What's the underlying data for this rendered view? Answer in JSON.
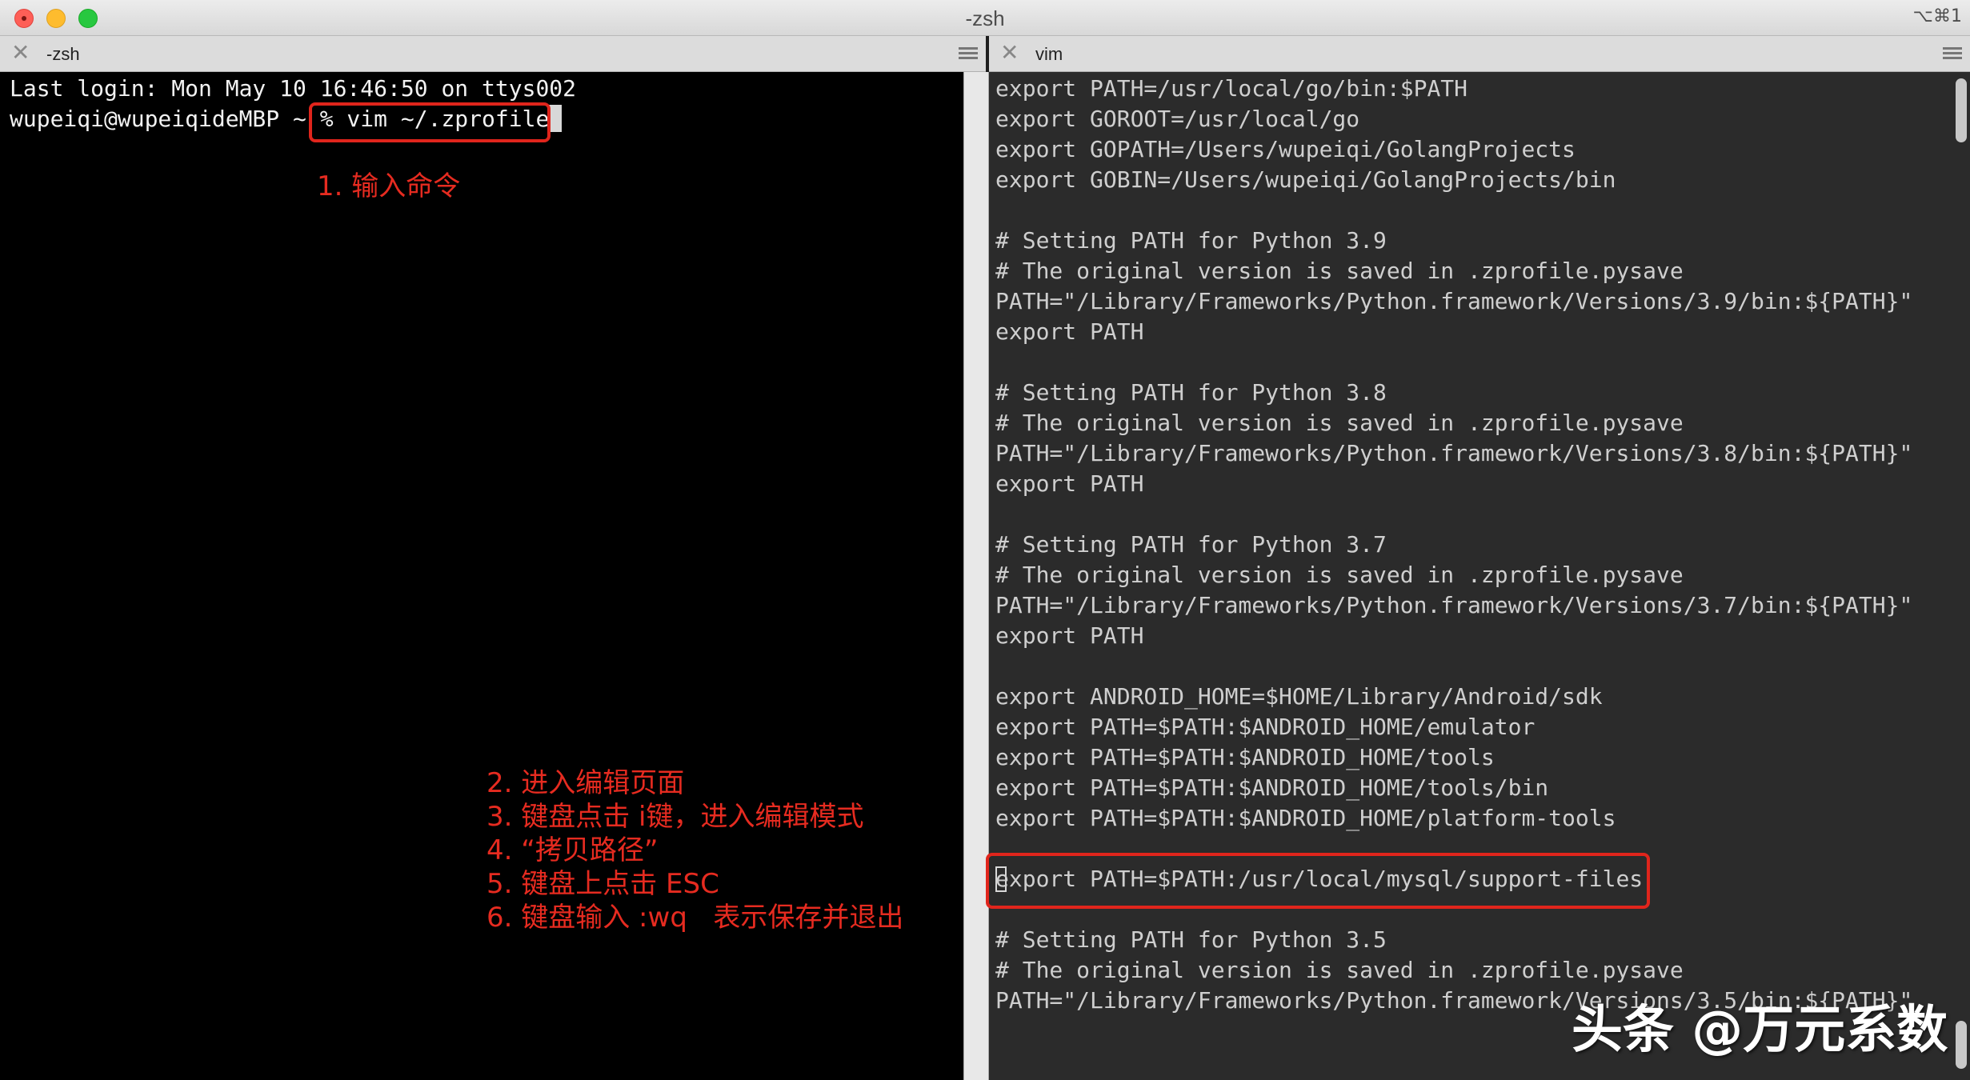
{
  "window": {
    "title": "-zsh",
    "shortcut": "⌥⌘1"
  },
  "tabs": {
    "left": {
      "label": "-zsh"
    },
    "right": {
      "label": "vim"
    }
  },
  "left_terminal": {
    "lines": [
      "Last login: Mon May 10 16:46:50 on ttys002",
      "wupeiqi@wupeiqideMBP ~ % vim ~/.zprofile"
    ]
  },
  "annotations": {
    "step1": "1. 输入命令",
    "steps": [
      "2. 进入编辑页面",
      "3. 键盘点击 i键，进入编辑模式",
      "4. “拷贝路径”",
      "5. 键盘上点击 ESC",
      "6. 键盘输入 :wq   表示保存并退出"
    ]
  },
  "vim_lines": [
    "export PATH=/usr/local/go/bin:$PATH",
    "export GOROOT=/usr/local/go",
    "export GOPATH=/Users/wupeiqi/GolangProjects",
    "export GOBIN=/Users/wupeiqi/GolangProjects/bin",
    "",
    "# Setting PATH for Python 3.9",
    "# The original version is saved in .zprofile.pysave",
    "PATH=\"/Library/Frameworks/Python.framework/Versions/3.9/bin:${PATH}\"",
    "export PATH",
    "",
    "# Setting PATH for Python 3.8",
    "# The original version is saved in .zprofile.pysave",
    "PATH=\"/Library/Frameworks/Python.framework/Versions/3.8/bin:${PATH}\"",
    "export PATH",
    "",
    "# Setting PATH for Python 3.7",
    "# The original version is saved in .zprofile.pysave",
    "PATH=\"/Library/Frameworks/Python.framework/Versions/3.7/bin:${PATH}\"",
    "export PATH",
    "",
    "export ANDROID_HOME=$HOME/Library/Android/sdk",
    "export PATH=$PATH:$ANDROID_HOME/emulator",
    "export PATH=$PATH:$ANDROID_HOME/tools",
    "export PATH=$PATH:$ANDROID_HOME/tools/bin",
    "export PATH=$PATH:$ANDROID_HOME/platform-tools",
    "",
    "export PATH=$PATH:/usr/local/mysql/support-files",
    "",
    "# Setting PATH for Python 3.5",
    "# The original version is saved in .zprofile.pysave",
    "PATH=\"/Library/Frameworks/Python.framework/Versions/3.5/bin:${PATH}\""
  ],
  "watermark": "头条 @万元系数",
  "colors": {
    "annotation_red": "#e62b20",
    "terminal_bg": "#000000",
    "vim_bg": "#2b2b2b"
  }
}
